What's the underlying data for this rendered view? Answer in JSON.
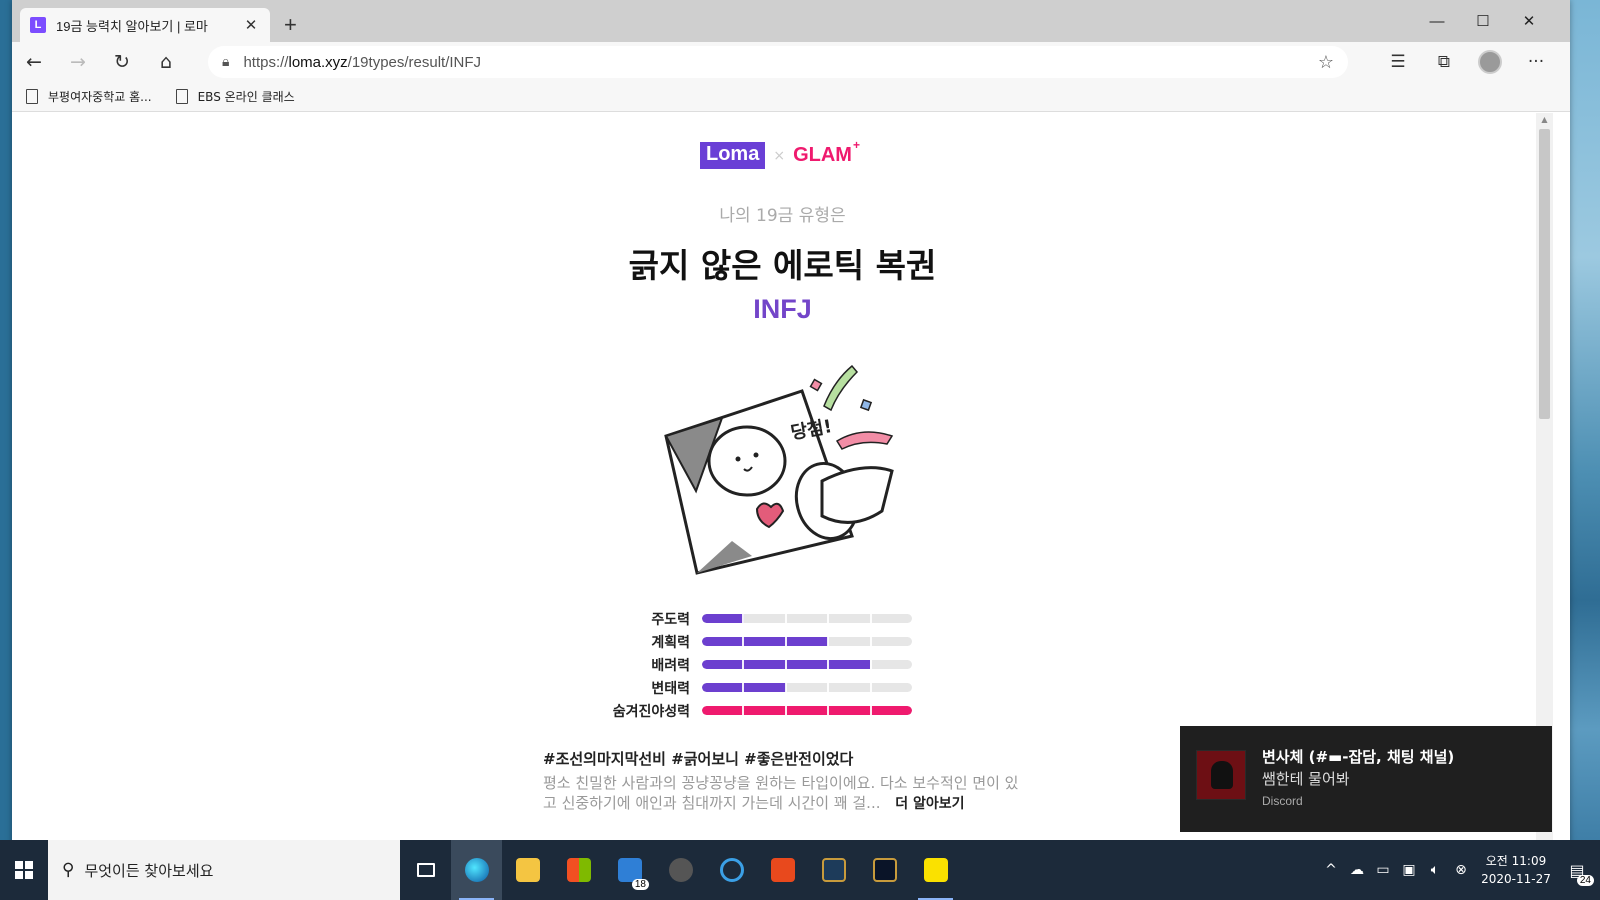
{
  "browser": {
    "tab_title": "19금 능력치 알아보기 | 로마",
    "tab_favicon": "L",
    "new_tab_label": "+",
    "win_controls": [
      "—",
      "☐",
      "✕"
    ],
    "url_prefix": "https://",
    "url_domain": "loma.xyz",
    "url_path": "/19types/result/INFJ",
    "bookmarks": [
      "부평여자중학교 홈...",
      "EBS 온라인 클래스"
    ]
  },
  "page": {
    "logo_loma": "Loma",
    "logo_times": "×",
    "logo_glam": "GLAM",
    "logo_glam_mark": "+",
    "subtitle": "나의 19금 유형은",
    "type_title": "긁지 않은 에로틱 복권",
    "mbti": "INFJ",
    "stats": [
      {
        "label": "주도력",
        "level": 0.2,
        "color": "#6c3fcf"
      },
      {
        "label": "계획력",
        "level": 0.6,
        "color": "#6c3fcf"
      },
      {
        "label": "배려력",
        "level": 0.8,
        "color": "#6c3fcf"
      },
      {
        "label": "변태력",
        "level": 0.4,
        "color": "#6c3fcf"
      },
      {
        "label": "숨겨진야성력",
        "level": 1.0,
        "color": "#ef1a6e"
      }
    ],
    "hashtags": "#조선의마지막선비 #긁어보니 #좋은반전이었다",
    "description": "평소 친밀한 사람과의 꽁냥꽁냥을 원하는 타입이에요. 다소 보수적인 면이 있고 신중하기에 애인과 침대까지 가는데 시간이 꽤 걸...",
    "more_label": "더 알아보기",
    "illust_caption": "당첨!"
  },
  "notification": {
    "title": "변사체 (#▬-잡담, 채팅 채널)",
    "message": "쌤한테 물어봐",
    "app": "Discord"
  },
  "taskbar": {
    "search_placeholder": "무엇이든 찾아보세요",
    "mail_badge": "18",
    "clock_time": "오전 11:09",
    "clock_date": "2020-11-27",
    "notif_count": "24"
  },
  "colors": {
    "accent_purple": "#6c3fcf",
    "accent_pink": "#ef1a6e"
  }
}
